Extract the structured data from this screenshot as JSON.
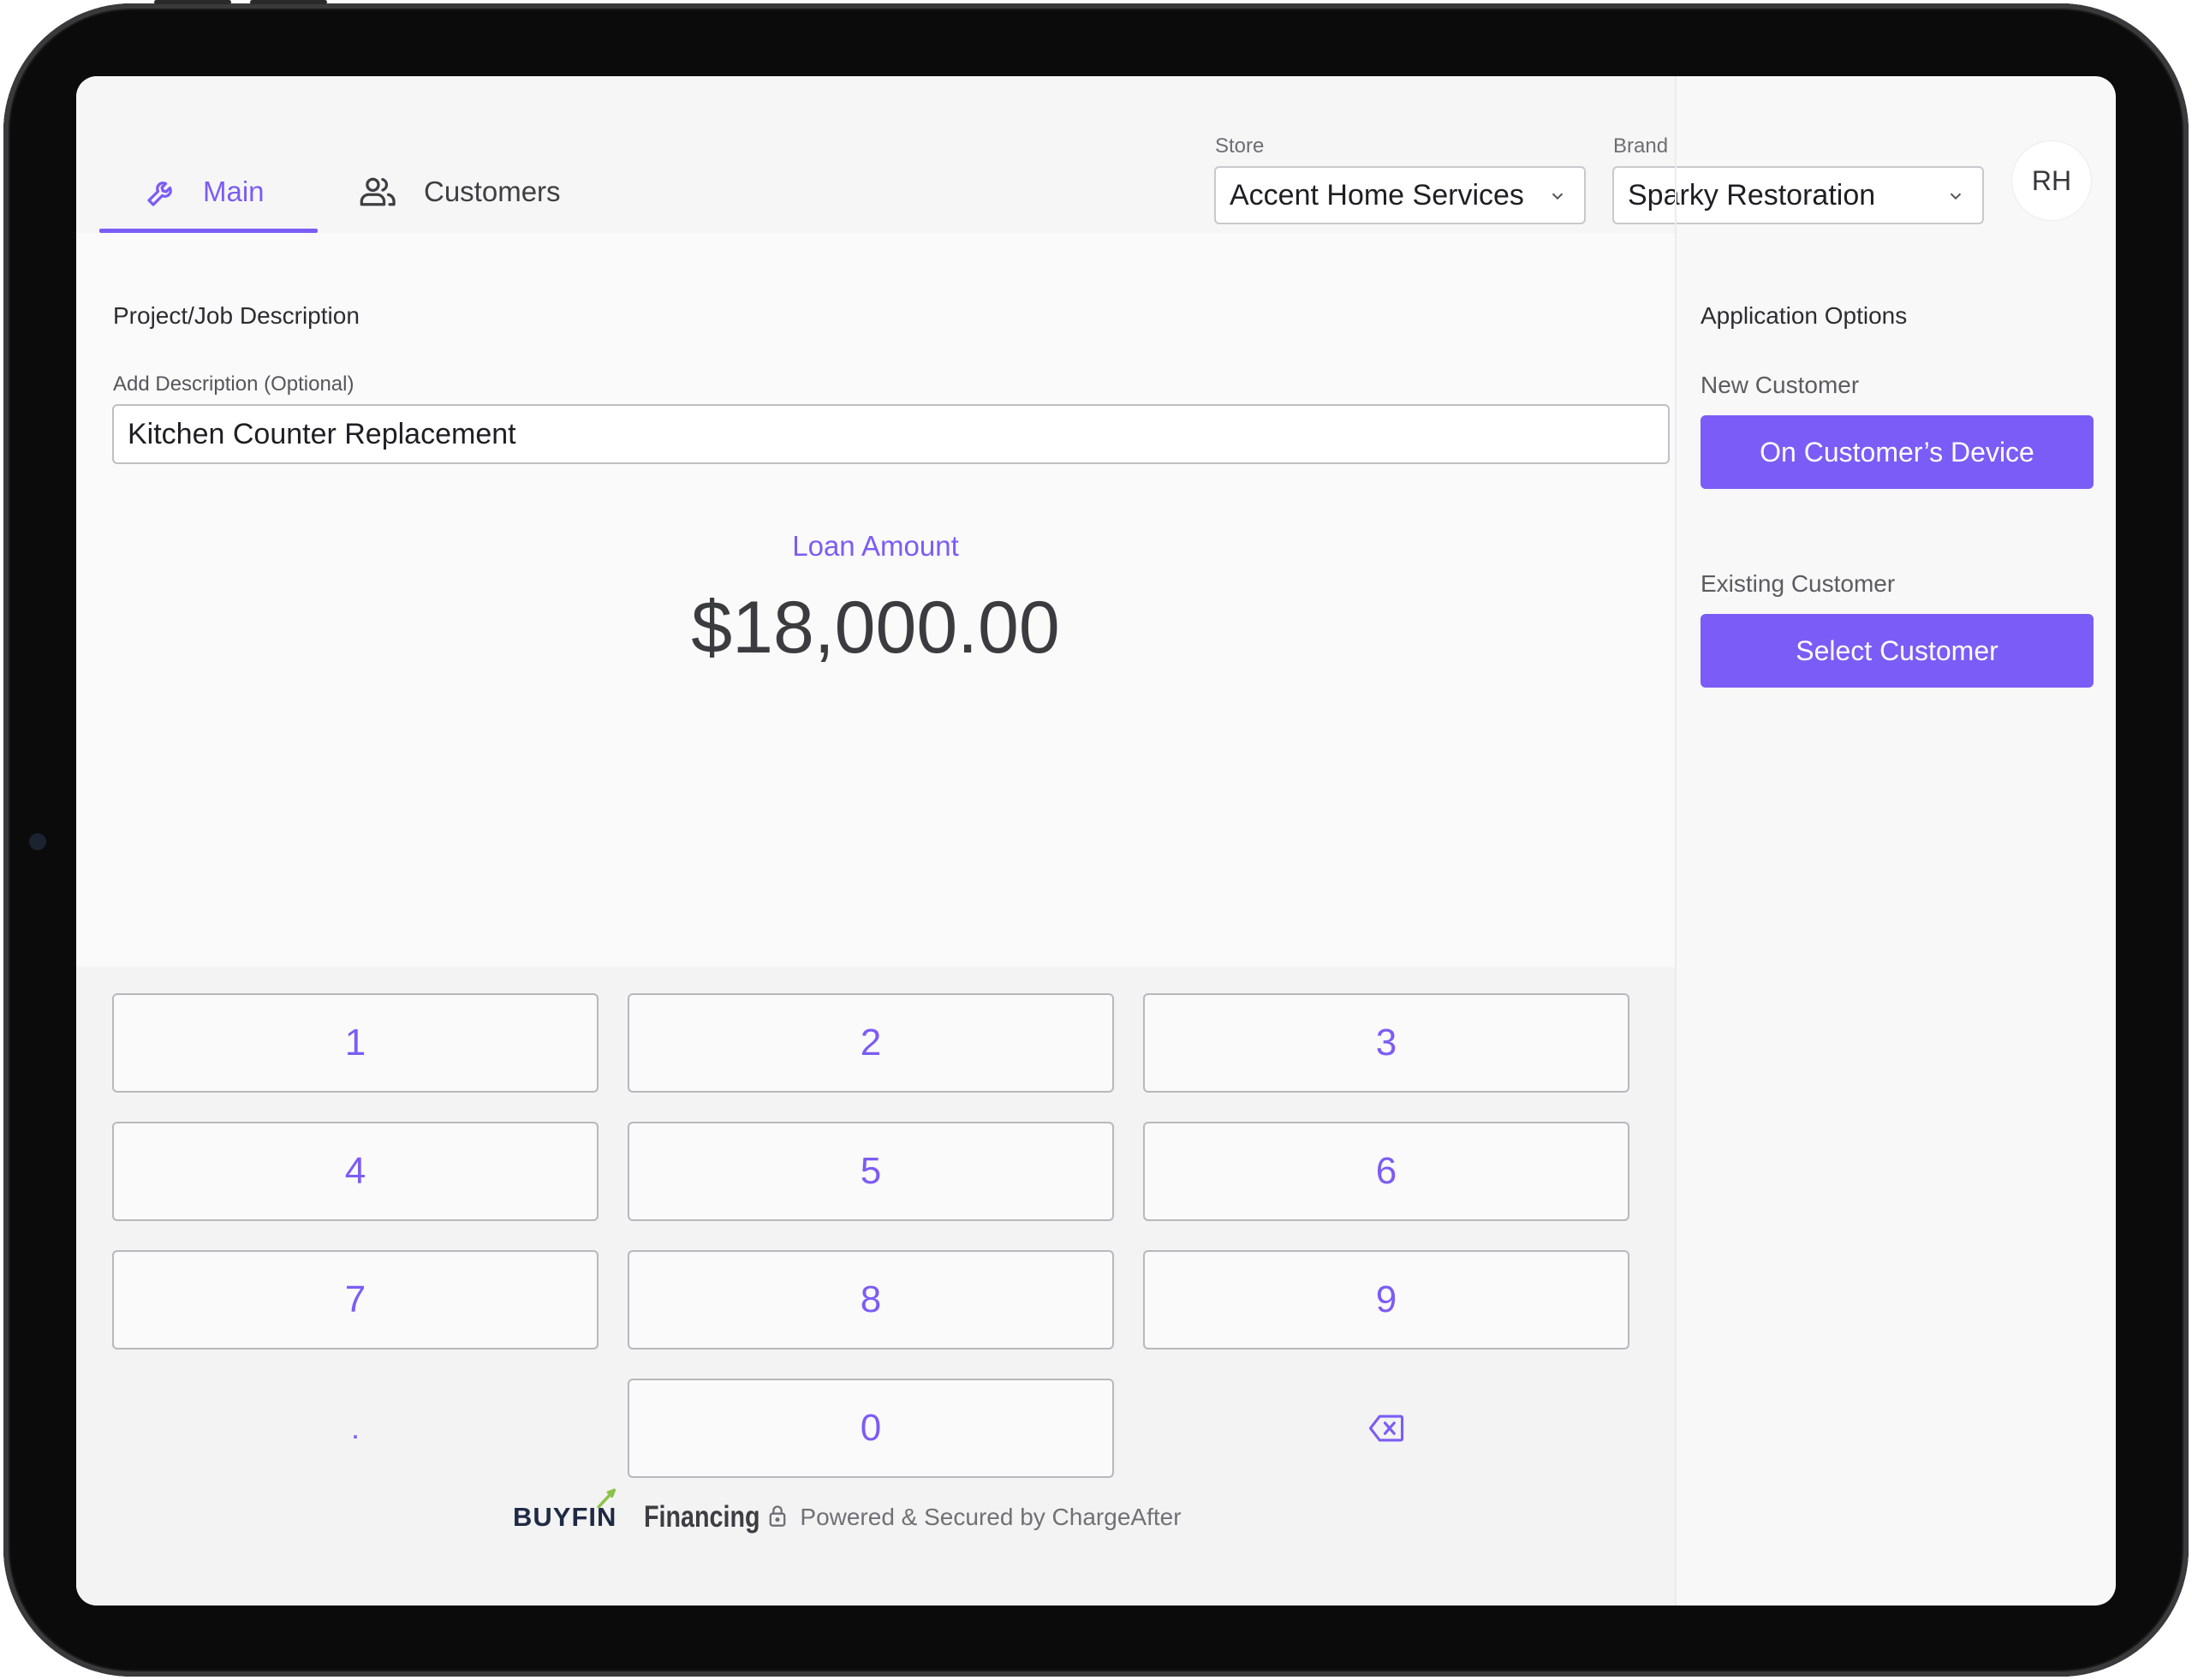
{
  "header": {
    "tabs": [
      {
        "label": "Main",
        "icon": "wrench-icon",
        "active": true
      },
      {
        "label": "Customers",
        "icon": "users-icon",
        "active": false
      }
    ],
    "store": {
      "label": "Store",
      "value": "Accent Home Services"
    },
    "brand": {
      "label": "Brand",
      "value": "Sparky Restoration"
    },
    "avatar_initials": "RH"
  },
  "main": {
    "section_title": "Project/Job Description",
    "description_label": "Add Description (Optional)",
    "description_value": "Kitchen Counter Replacement",
    "loan_label": "Loan Amount",
    "loan_value": "$18,000.00"
  },
  "keypad": {
    "keys": [
      "1",
      "2",
      "3",
      "4",
      "5",
      "6",
      "7",
      "8",
      "9",
      ".",
      "0"
    ],
    "backspace_icon": "backspace-icon"
  },
  "footer": {
    "logo": "BUYFIN",
    "financing": "Financing",
    "powered": "Powered & Secured by ChargeAfter"
  },
  "sidebar": {
    "title": "Application Options",
    "new_customer_label": "New Customer",
    "new_customer_button": "On Customer’s Device",
    "existing_customer_label": "Existing Customer",
    "existing_customer_button": "Select Customer"
  },
  "colors": {
    "accent": "#7c5cf5",
    "logo_dark": "#1f2a44",
    "logo_leaf": "#8bc34a"
  }
}
